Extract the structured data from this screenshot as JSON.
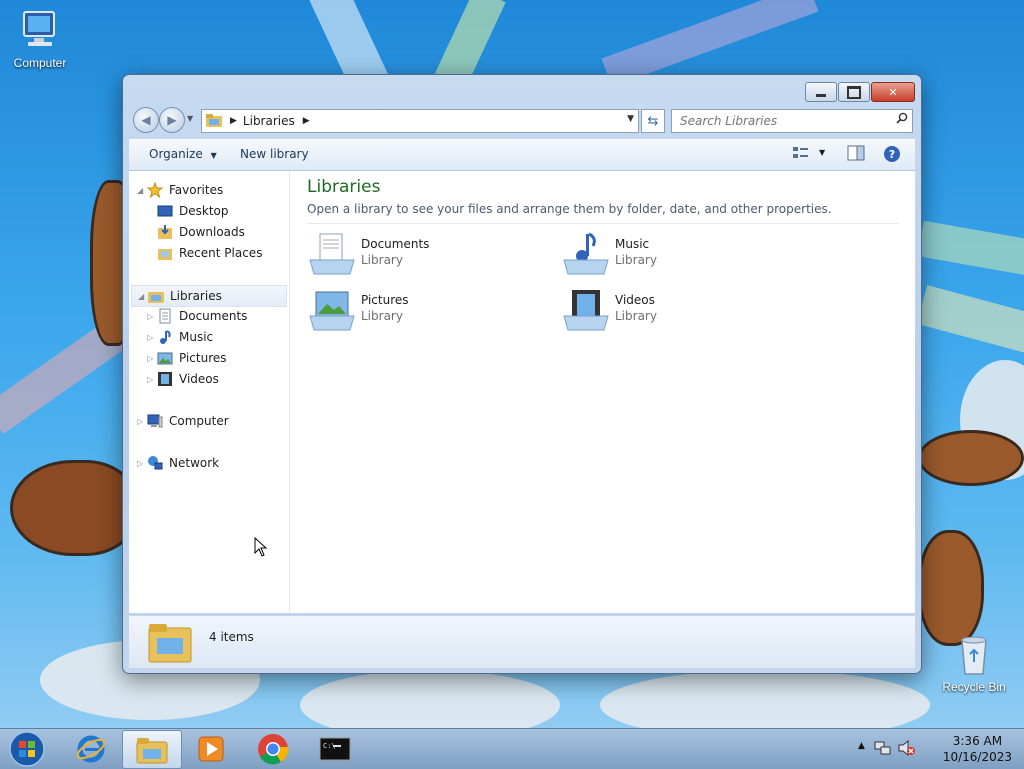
{
  "desktop": {
    "icons": [
      {
        "label": "Computer"
      },
      {
        "label": "Recycle Bin"
      }
    ]
  },
  "window": {
    "address": {
      "segment": "Libraries"
    },
    "search": {
      "placeholder": "Search Libraries"
    },
    "toolbar": {
      "organize": "Organize",
      "new_library": "New library"
    },
    "nav": {
      "favorites": "Favorites",
      "desktop": "Desktop",
      "downloads": "Downloads",
      "recent": "Recent Places",
      "libraries": "Libraries",
      "documents": "Documents",
      "music": "Music",
      "pictures": "Pictures",
      "videos": "Videos",
      "computer": "Computer",
      "network": "Network"
    },
    "main": {
      "title": "Libraries",
      "subtitle": "Open a library to see your files and arrange them by folder, date, and other properties.",
      "items": [
        {
          "name": "Documents",
          "type": "Library"
        },
        {
          "name": "Music",
          "type": "Library"
        },
        {
          "name": "Pictures",
          "type": "Library"
        },
        {
          "name": "Videos",
          "type": "Library"
        }
      ]
    },
    "status": {
      "count": "4 items"
    }
  },
  "taskbar": {
    "clock": {
      "time": "3:36 AM",
      "date": "10/16/2023"
    }
  },
  "colors": {
    "title_green": "#1e6a21",
    "close_red": "#c7402a",
    "desktop_blue": "#3aa6ec"
  }
}
